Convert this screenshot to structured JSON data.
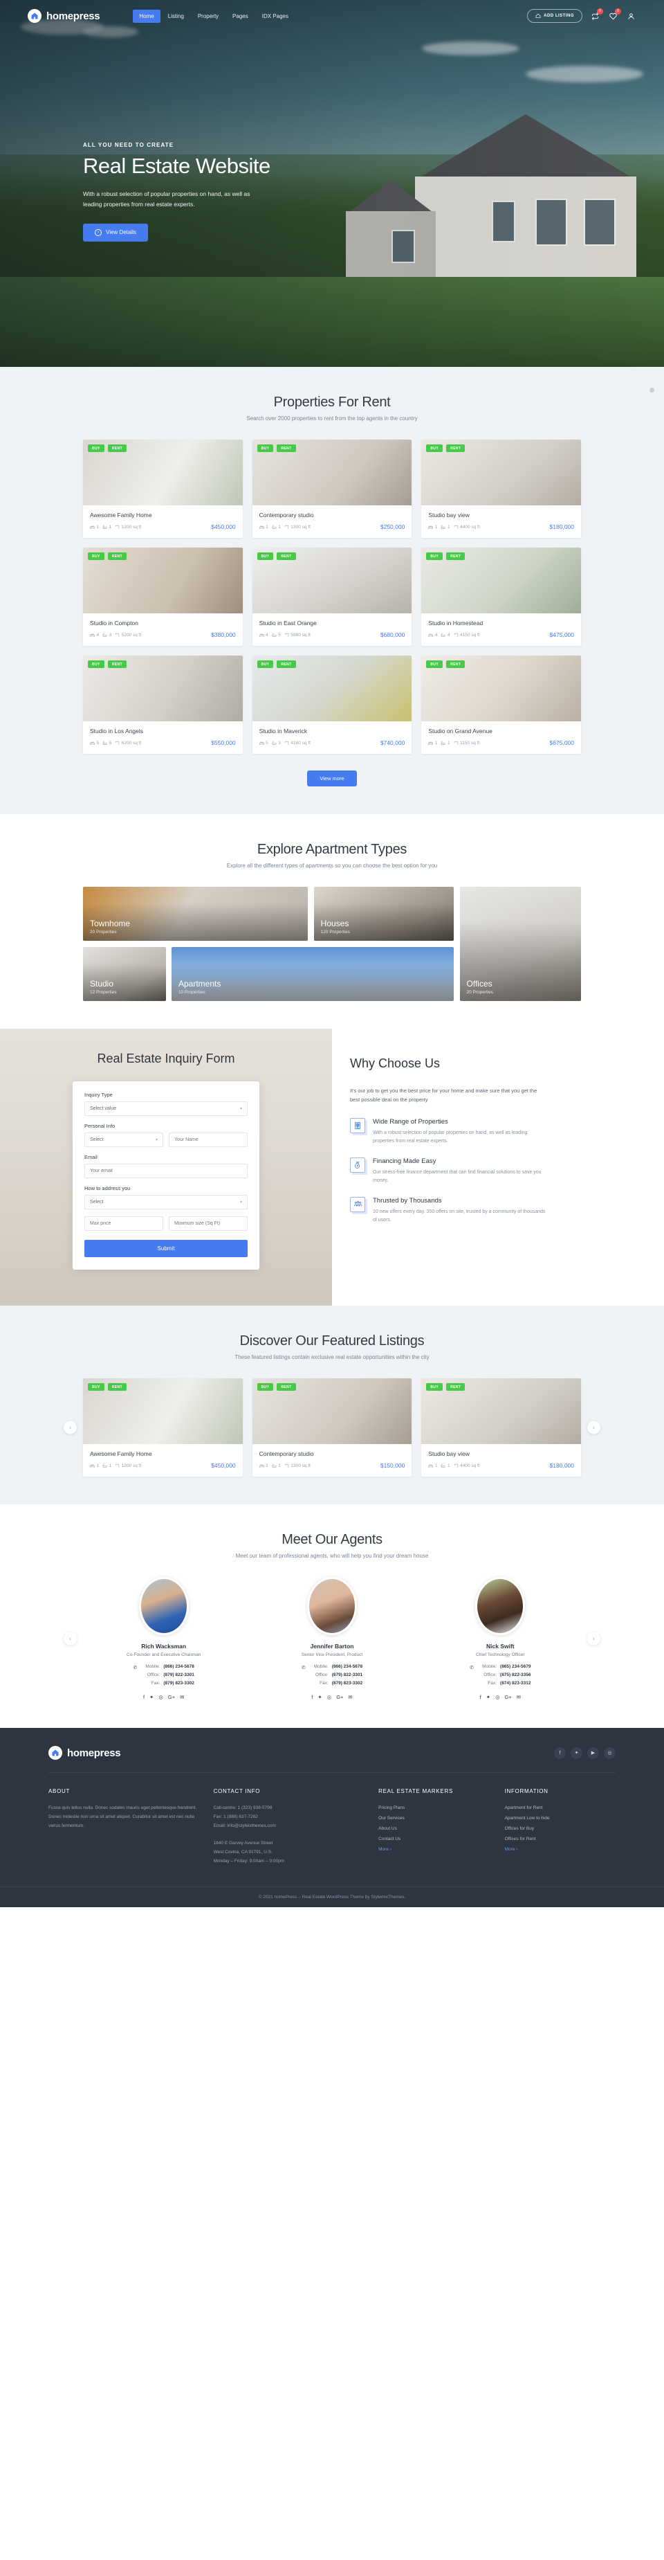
{
  "brand": {
    "name": "homepress",
    "icon": "home-icon"
  },
  "nav": {
    "items": [
      {
        "label": "Home",
        "active": true
      },
      {
        "label": "Listing",
        "active": false
      },
      {
        "label": "Property",
        "active": false
      },
      {
        "label": "Pages",
        "active": false
      },
      {
        "label": "IDX Pages",
        "active": false
      }
    ],
    "add_listing_label": "ADD LISTING",
    "compare_badge": "0",
    "favorites_badge": "0"
  },
  "hero": {
    "kicker": "ALL YOU NEED TO CREATE",
    "title": "Real Estate Website",
    "subtitle": "With a robust selection of popular properties on hand, as well as leading properties from real estate experts.",
    "cta": "View Details"
  },
  "rent": {
    "title": "Properties For Rent",
    "subtitle": "Search over 2000 properties to rent from the top agents in the country",
    "view_more": "View more",
    "cards": [
      {
        "title": "Awesome Family Home",
        "beds": "1",
        "baths": "1",
        "area": "1200 sq ft",
        "price": "$450,000",
        "tags": [
          "BUY",
          "RENT"
        ]
      },
      {
        "title": "Contemporary studio",
        "beds": "1",
        "baths": "1",
        "area": "1300 sq ft",
        "price": "$250,000",
        "tags": [
          "BUY",
          "RENT"
        ]
      },
      {
        "title": "Studio bay view",
        "beds": "1",
        "baths": "1",
        "area": "4400 sq ft",
        "price": "$180,000",
        "tags": [
          "BUY",
          "RENT"
        ]
      },
      {
        "title": "Studio in Compton",
        "beds": "4",
        "baths": "3",
        "area": "5200 sq ft",
        "price": "$380,000",
        "tags": [
          "BUY",
          "RENT"
        ]
      },
      {
        "title": "Studio in East Orange",
        "beds": "4",
        "baths": "5",
        "area": "5980 sq ft",
        "price": "$680,000",
        "tags": [
          "BUY",
          "RENT"
        ]
      },
      {
        "title": "Studio in Homestead",
        "beds": "4",
        "baths": "4",
        "area": "4150 sq ft",
        "price": "$475,000",
        "tags": [
          "BUY",
          "RENT"
        ]
      },
      {
        "title": "Studio in Los Angels",
        "beds": "5",
        "baths": "5",
        "area": "6200 sq ft",
        "price": "$550,000",
        "tags": [
          "BUY",
          "RENT"
        ]
      },
      {
        "title": "Studio in Maverick",
        "beds": "5",
        "baths": "3",
        "area": "4180 sq ft",
        "price": "$740,000",
        "tags": [
          "BUY",
          "RENT"
        ]
      },
      {
        "title": "Studio on Grand Avenue",
        "beds": "1",
        "baths": "1",
        "area": "1150 sq ft",
        "price": "$675,000",
        "tags": [
          "BUY",
          "RENT"
        ]
      }
    ]
  },
  "types": {
    "title": "Explore Apartment Types",
    "subtitle": "Explore all the different types of apartments so you can choose the best option for you",
    "items": [
      {
        "name": "Townhome",
        "count": "20 Properties"
      },
      {
        "name": "Houses",
        "count": "120 Properties"
      },
      {
        "name": "Offices",
        "count": "20 Properties"
      },
      {
        "name": "Studio",
        "count": "12 Properties"
      },
      {
        "name": "Apartments",
        "count": "10 Properties"
      }
    ]
  },
  "inquiry": {
    "title": "Real Estate Inquiry Form",
    "fields": {
      "inquiry_type_label": "Inquiry Type",
      "inquiry_type_value": "Select value",
      "personal_info_label": "Personal Info",
      "personal_select_value": "Select",
      "name_placeholder": "Your Name",
      "email_label": "Email",
      "email_placeholder": "Your email",
      "address_label": "How to address you",
      "address_select_value": "Select",
      "max_price_placeholder": "Max price",
      "min_size_placeholder": "Minimum size (Sq Ft)"
    },
    "submit": "Submit"
  },
  "why": {
    "title": "Why Choose Us",
    "lead": "It's our job to get you the best price for your home and make sure that you get the best possible deal on the property",
    "features": [
      {
        "icon": "building-icon",
        "title": "Wide Range of Properties",
        "desc": "With a robust selection of popular properties on hand, as well as leading properties from real estate experts."
      },
      {
        "icon": "money-bag-icon",
        "title": "Financing Made Easy",
        "desc": "Our stress-free finance department that can find financial solutions to save you money."
      },
      {
        "icon": "people-icon",
        "title": "Thrusted by Thousands",
        "desc": "10 new offers every day. 350 offers on site, trusted by a community of thousands of users."
      }
    ]
  },
  "featured": {
    "title": "Discover Our Featured Listings",
    "subtitle": "These featured listings contain exclusive real estate opportunities within the city",
    "cards": [
      {
        "title": "Awesome Family Home",
        "beds": "1",
        "baths": "1",
        "area": "1200 sq ft",
        "price": "$450,000",
        "tags": [
          "BUY",
          "RENT"
        ]
      },
      {
        "title": "Contemporary studio",
        "beds": "1",
        "baths": "1",
        "area": "1300 sq ft",
        "price": "$150,000",
        "tags": [
          "BUY",
          "RENT"
        ]
      },
      {
        "title": "Studio bay view",
        "beds": "1",
        "baths": "1",
        "area": "4400 sq ft",
        "price": "$180,000",
        "tags": [
          "BUY",
          "RENT"
        ]
      }
    ]
  },
  "agents": {
    "title": "Meet Our Agents",
    "subtitle": "Meet our team of professional agents, who will help you find your dream house",
    "labels": {
      "mobile": "Mobile:",
      "office": "Office:",
      "fax": "Fax:"
    },
    "items": [
      {
        "name": "Rich Wacksman",
        "role": "Co-Founder and Executive Chairman",
        "mobile": "(866) 234-5678",
        "office": "(879) 822-3301",
        "fax": "(879) 823-3302"
      },
      {
        "name": "Jennifer Barton",
        "role": "Senior Vice President, Product",
        "mobile": "(866) 234-5678",
        "office": "(879) 822-3301",
        "fax": "(879) 823-3302"
      },
      {
        "name": "Nick Swift",
        "role": "Chief Technology Officer",
        "mobile": "(865) 234-5679",
        "office": "(875) 822-3356",
        "fax": "(874) 823-3312"
      }
    ]
  },
  "footer": {
    "brand": "homepress",
    "socials": [
      "facebook-icon",
      "twitter-icon",
      "youtube-icon",
      "instagram-icon"
    ],
    "about": {
      "heading": "ABOUT",
      "text": "Fusce quis tellus nulla. Donec sodales mauris eget pellentesque hendrerit. Donec molestie non urna sit amet aliquet. Curabitur sit amet est nec nulla varius fermentum."
    },
    "contact": {
      "heading": "CONTACT INFO",
      "call": "Call-centre: 1 (323) 938-5798",
      "fax": "Fax: 1 (888) 637-7262",
      "email": "Email: info@styleixthemes.com",
      "address1": "1840 E Garvey Avenue Street",
      "address2": "West Covina, CA 91791, U.S.",
      "hours": "Monday – Friday: 9:00am – 9:00pm"
    },
    "markers": {
      "heading": "REAL ESTATE MARKERS",
      "links": [
        "Pricing Plans",
        "Our Services",
        "About Us",
        "Contact Us"
      ],
      "more": "More ›"
    },
    "information": {
      "heading": "INFORMATION",
      "links": [
        "Apartment for Rent",
        "Apartment Low to hide",
        "Offices for Buy",
        "Offices for Rent"
      ],
      "more": "More ›"
    },
    "copyright": "© 2021 homePress – Real Estate WordPress Theme by StylemixThemes."
  },
  "colors": {
    "accent": "#477bf0",
    "tag": "#47c949",
    "dark": "#2f3441"
  }
}
